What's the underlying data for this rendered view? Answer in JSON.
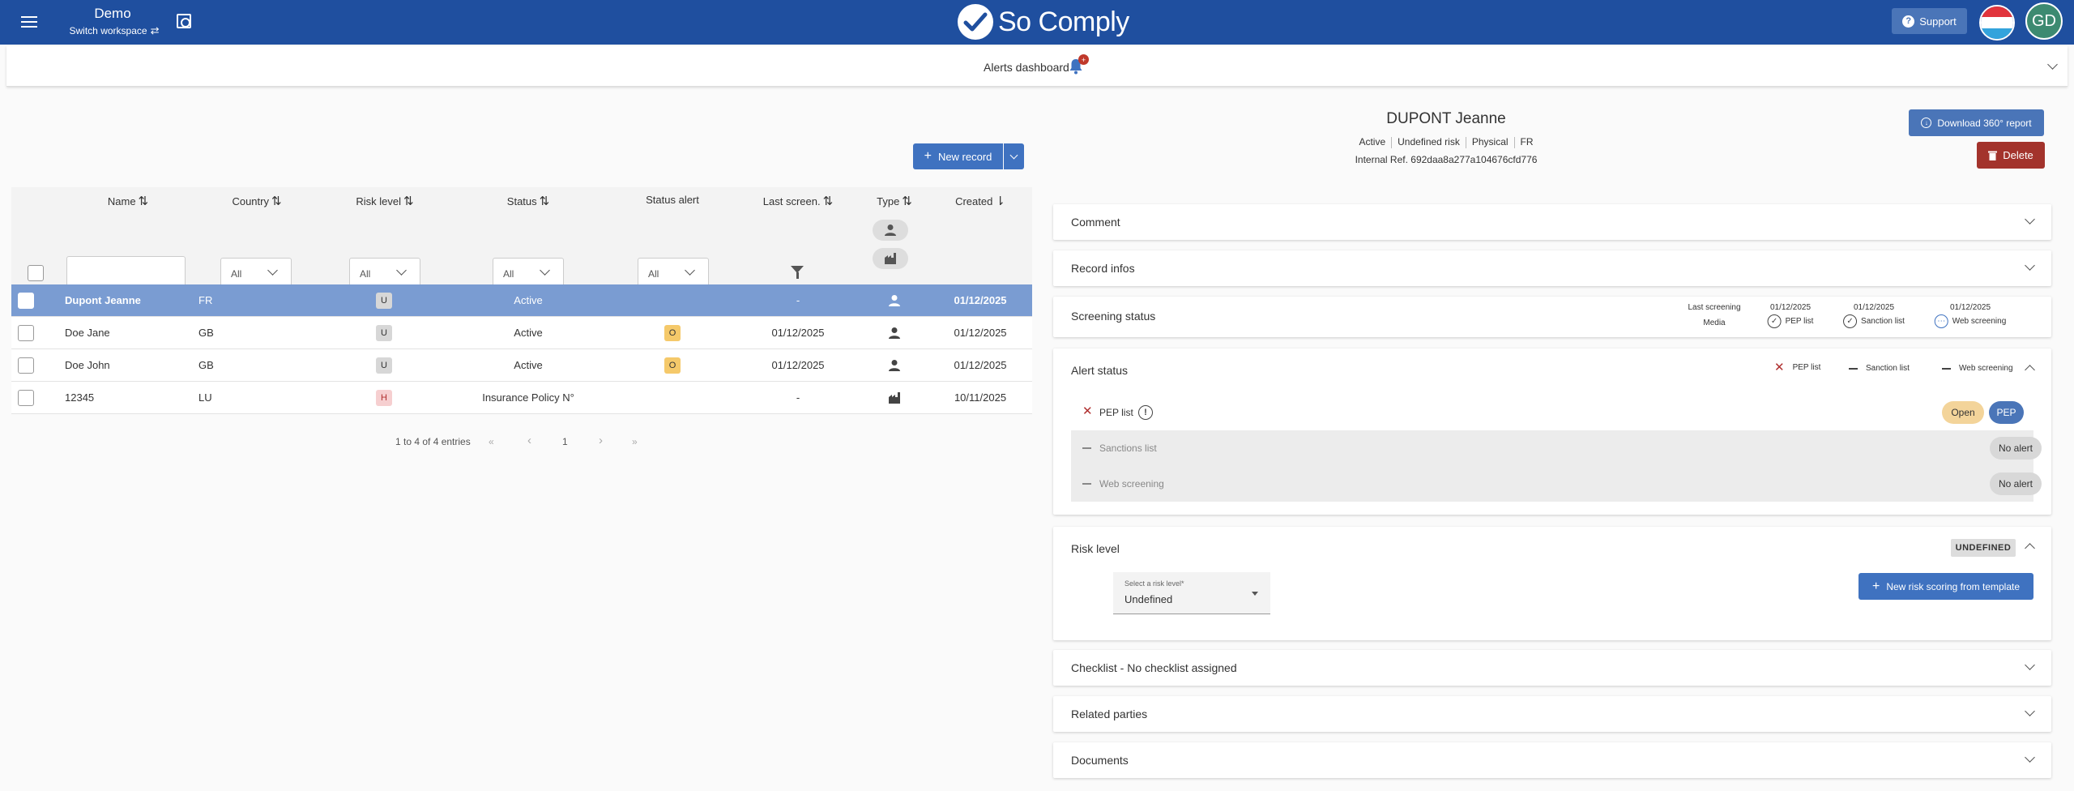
{
  "topbar": {
    "workspace_name": "Demo",
    "switch_label": "Switch workspace",
    "logo_text": "So Comply",
    "support_label": "Support",
    "avatar_initials": "GD",
    "colors": {
      "bar": "#1f4f9f",
      "accent": "#3f72c0",
      "danger": "#a3332c"
    }
  },
  "alerts_bar": {
    "title": "Alerts dashboard",
    "badge": "+"
  },
  "records": {
    "new_record_label": "New record",
    "columns": {
      "name": "Name",
      "country": "Country",
      "risk_level": "Risk level",
      "status": "Status",
      "status_alert": "Status alert",
      "last_screen": "Last screen.",
      "type": "Type",
      "created": "Created"
    },
    "filters": {
      "country": "All",
      "risk_level": "All",
      "status": "All",
      "status_alert": "All",
      "name": ""
    },
    "rows": [
      {
        "name": "Dupont Jeanne",
        "country": "FR",
        "risk": "U",
        "status": "Active",
        "alert": "",
        "last_screen": "-",
        "type": "person-icon",
        "created": "01/12/2025"
      },
      {
        "name": "Doe Jane",
        "country": "GB",
        "risk": "U",
        "status": "Active",
        "alert": "O",
        "last_screen": "01/12/2025",
        "type": "person-icon",
        "created": "01/12/2025"
      },
      {
        "name": "Doe John",
        "country": "GB",
        "risk": "U",
        "status": "Active",
        "alert": "O",
        "last_screen": "01/12/2025",
        "type": "person-icon",
        "created": "01/12/2025"
      },
      {
        "name": "12345",
        "country": "LU",
        "risk": "H",
        "status": "Insurance Policy N°",
        "alert": "",
        "last_screen": "-",
        "type": "factory-icon",
        "created": "10/11/2025"
      }
    ],
    "pager": {
      "summary": "1 to 4 of 4 entries",
      "first": "«",
      "prev": "‹",
      "page": "1",
      "next": "›",
      "last": "»"
    }
  },
  "record": {
    "name": "DUPONT Jeanne",
    "status": "Active",
    "risk": "Undefined risk",
    "type": "Physical",
    "country": "FR",
    "internal_ref": "Internal Ref. 692daa8a277a104676cfd776",
    "download_label": "Download 360° report",
    "delete_label": "Delete"
  },
  "panels": {
    "comment": "Comment",
    "record_infos": "Record infos",
    "screening_status": {
      "title": "Screening status",
      "last_screening_label": "Last screening",
      "media_label": "Media",
      "pep_date": "01/12/2025",
      "pep_label": "PEP list",
      "sanction_date": "01/12/2025",
      "sanction_label": "Sanction list",
      "web_date": "01/12/2025",
      "web_label": "Web screening"
    },
    "alert_status": {
      "title": "Alert status",
      "summary": {
        "pep": "PEP list",
        "sanction": "Sanction list",
        "web": "Web screening"
      },
      "rows": [
        {
          "label": "PEP list",
          "info": "!",
          "open": "Open",
          "tag": "PEP"
        },
        {
          "label": "Sanctions list",
          "state": "No alert"
        },
        {
          "label": "Web screening",
          "state": "No alert"
        }
      ]
    },
    "risk_level": {
      "title": "Risk level",
      "badge": "UNDEFINED",
      "select_label": "Select a risk level*",
      "select_value": "Undefined",
      "new_scoring_label": "New risk scoring from template"
    },
    "checklist": "Checklist - No checklist assigned",
    "related_parties": "Related parties",
    "documents": "Documents"
  }
}
